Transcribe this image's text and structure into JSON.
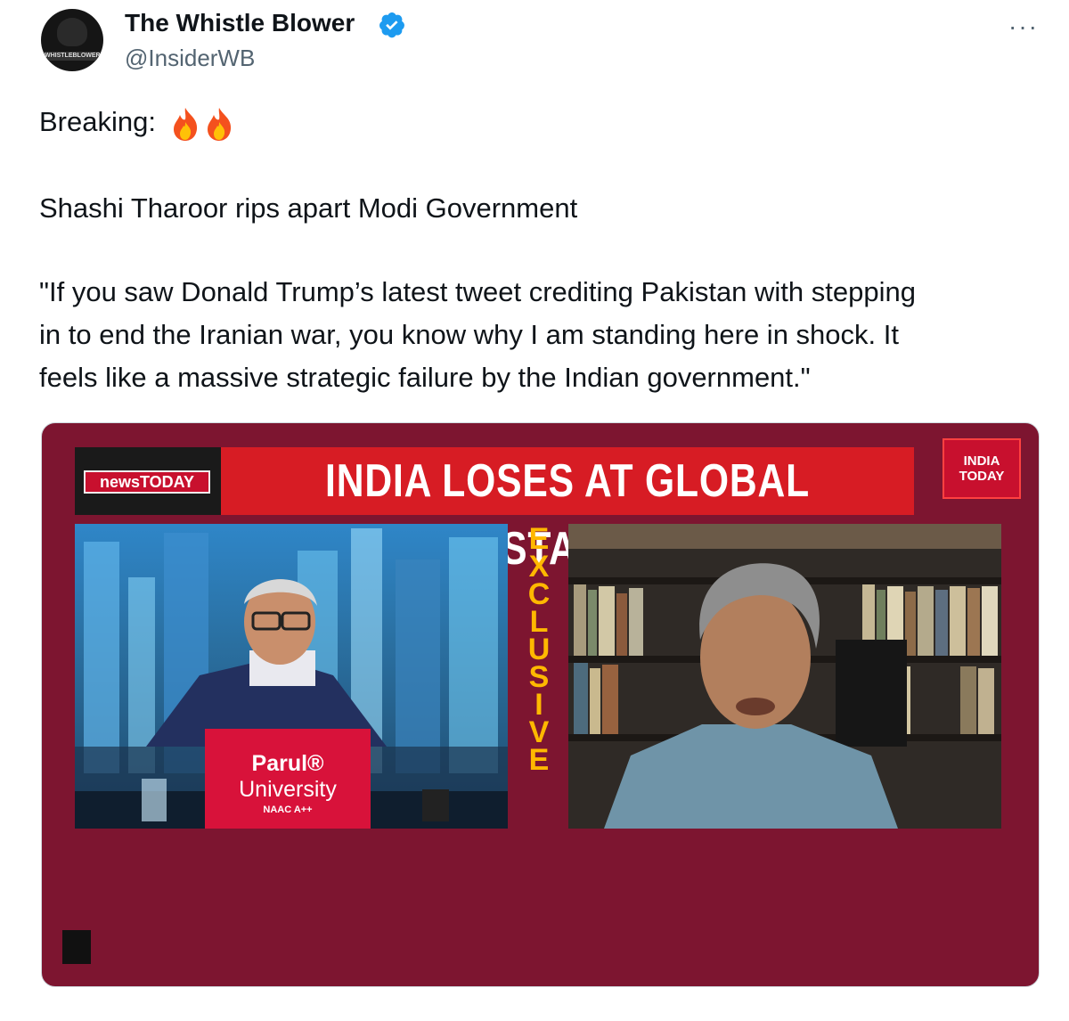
{
  "tweet": {
    "author_name": "The Whistle Blower",
    "handle": "@InsiderWB",
    "avatar_text": "WHISTLEBLOWER",
    "more": "···",
    "paragraphs": [
      "Breaking:",
      "Shashi Tharoor rips apart Modi Government",
      "\"If you saw Donald Trump’s latest tweet crediting Pakistan with stepping",
      "in to end the Iranian war, you know why I am standing here in shock. It",
      "feels like a massive strategic failure by the Indian government.\""
    ],
    "emoji": [
      "fire",
      "fire"
    ]
  },
  "video": {
    "channel_badge": "newsTODAY",
    "headline": "INDIA LOSES AT GLOBAL STAGE",
    "logo_line1": "INDIA",
    "logo_line2": "TODAY",
    "exclusive_letters": [
      "E",
      "X",
      "C",
      "L",
      "U",
      "S",
      "I",
      "V",
      "E"
    ],
    "desk_sign": {
      "line1": "Parul®",
      "line2": "University",
      "line3": "NAAC A++"
    }
  },
  "colors": {
    "card_bg": "#7d1530",
    "banner_red": "#d71c24",
    "exclusive_yellow": "#ffb800",
    "verified_blue": "#1d9bf0"
  }
}
